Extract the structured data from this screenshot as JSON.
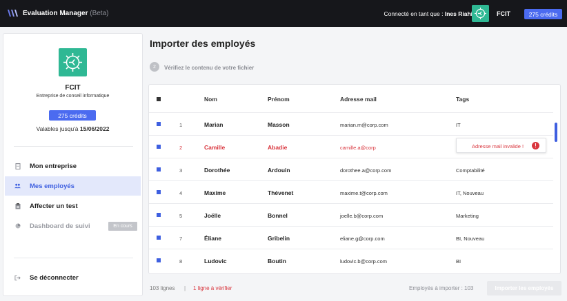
{
  "header": {
    "app_title": "Evaluation Manager",
    "beta_label": "(Beta)",
    "login_prefix": "Connecté en tant que : ",
    "user_name": "Ines Riahi",
    "company": "FCIT",
    "credits": "275 crédits"
  },
  "sidebar": {
    "company": "FCIT",
    "subtitle": "Entreprise de conseil informatique",
    "credits": "275 crédits",
    "valid_prefix": "Valables jusqu'à ",
    "valid_date": "15/06/2022",
    "nav": [
      {
        "label": "Mon entreprise",
        "icon": "building-icon"
      },
      {
        "label": "Mes employés",
        "icon": "users-icon"
      },
      {
        "label": "Affecter un test",
        "icon": "clipboard-icon"
      },
      {
        "label": "Dashboard de suivi",
        "icon": "chart-pie-icon",
        "badge": "En cours"
      }
    ],
    "logout": "Se déconnecter"
  },
  "main": {
    "title": "Importer des employés",
    "step_number": "2",
    "step_label": "Vérifiez le contenu de votre fichier",
    "columns": [
      "Nom",
      "Prénom",
      "Adresse mail",
      "Tags"
    ],
    "rows": [
      {
        "idx": "1",
        "nom": "Marian",
        "prenom": "Masson",
        "email": "marian.m@corp.com",
        "tags": "IT"
      },
      {
        "idx": "2",
        "nom": "Camille",
        "prenom": "Abadie",
        "email": "camille.a@corp",
        "tags": "",
        "error": "Adresse mail invalide !"
      },
      {
        "idx": "3",
        "nom": "Dorothée",
        "prenom": "Ardouin",
        "email": "dorothee.a@corp.com",
        "tags": "Comptabilité"
      },
      {
        "idx": "4",
        "nom": "Maxime",
        "prenom": "Thévenet",
        "email": "maxime.t@corp.com",
        "tags": "IT, Nouveau"
      },
      {
        "idx": "5",
        "nom": "Joëlle",
        "prenom": "Bonnel",
        "email": "joelle.b@corp.com",
        "tags": "Marketing"
      },
      {
        "idx": "7",
        "nom": "Éliane",
        "prenom": "Gribelin",
        "email": "eliane.g@corp.com",
        "tags": "BI, Nouveau"
      },
      {
        "idx": "8",
        "nom": "Ludovic",
        "prenom": "Boutin",
        "email": "ludovic.b@corp.com",
        "tags": "BI"
      }
    ],
    "footer": {
      "lines": "103 lignes",
      "separator": "|",
      "to_verify": "1 ligne à vérifier",
      "import_count": "Employés à importer : 103",
      "import_button": "Importer les employés"
    }
  },
  "colors": {
    "accent": "#4b6bf0",
    "error": "#d9363e",
    "logo": "#2fb894",
    "topbar": "#16171b"
  }
}
